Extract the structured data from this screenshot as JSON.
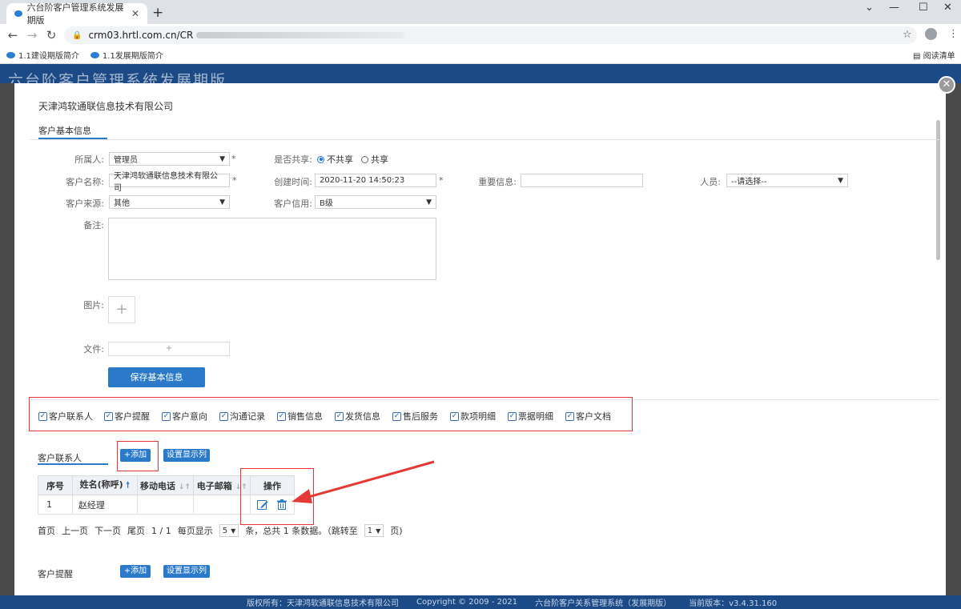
{
  "browser": {
    "tab_title": "六台阶客户管理系统发展期版",
    "tab_close": "✕",
    "new_tab": "+",
    "url": "crm03.hrtl.com.cn/CR",
    "bookmarks": [
      "1.1建设期版简介",
      "1.1发展期版简介"
    ],
    "reading_list": "阅读清单"
  },
  "app": {
    "title": "六台阶客户管理系统发展期版"
  },
  "modal": {
    "company": "天津鸿软通联信息技术有限公司",
    "section_tab": "客户基本信息",
    "form": {
      "owner_label": "所属人:",
      "owner_value": "管理员",
      "share_label": "是否共享:",
      "share_no": "不共享",
      "share_yes": "共享",
      "name_label": "客户名称:",
      "name_value": "天津鸿软通联信息技术有限公司",
      "created_label": "创建时间:",
      "created_value": "2020-11-20 14:50:23",
      "important_label": "重要信息:",
      "person_label": "人员:",
      "person_value": "--请选择--",
      "source_label": "客户来源:",
      "source_value": "其他",
      "credit_label": "客户信用:",
      "credit_value": "B级",
      "remark_label": "备注:",
      "image_label": "图片:",
      "file_label": "文件:",
      "required_mark": "*",
      "save_button": "保存基本信息"
    },
    "checkboxes": [
      "客户联系人",
      "客户提醒",
      "客户意向",
      "沟通记录",
      "销售信息",
      "发货信息",
      "售后服务",
      "款项明细",
      "票据明细",
      "客户文档"
    ],
    "contacts": {
      "title": "客户联系人",
      "add_button": "+添加",
      "columns_button": "设置显示列",
      "headers": [
        "序号",
        "姓名(称呼)",
        "移动电话",
        "电子邮箱",
        "操作"
      ],
      "rows": [
        {
          "no": "1",
          "name": "赵经理",
          "phone": "",
          "email": ""
        }
      ]
    },
    "pager": {
      "first": "首页",
      "prev": "上一页",
      "next": "下一页",
      "last": "尾页",
      "page": "1 / 1",
      "per_page_label": "每页显示",
      "per_page_value": "5",
      "summary": "条，总共 1 条数据。（跳转至",
      "jump_value": "1",
      "page_suffix": "页)"
    },
    "reminders": {
      "title": "客户提醒",
      "add_button": "+添加",
      "columns_button": "设置显示列"
    }
  },
  "footer": {
    "copyright": "版权所有：天津鸿软通联信息技术有限公司",
    "years": "Copyright © 2009 - 2021",
    "system": "六台阶客户关系管理系统（发展期版）",
    "version": "当前版本：v3.4.31.160"
  },
  "colors": {
    "accent": "#2b7ac9",
    "highlight": "#e53935",
    "header": "#1c4a86"
  }
}
